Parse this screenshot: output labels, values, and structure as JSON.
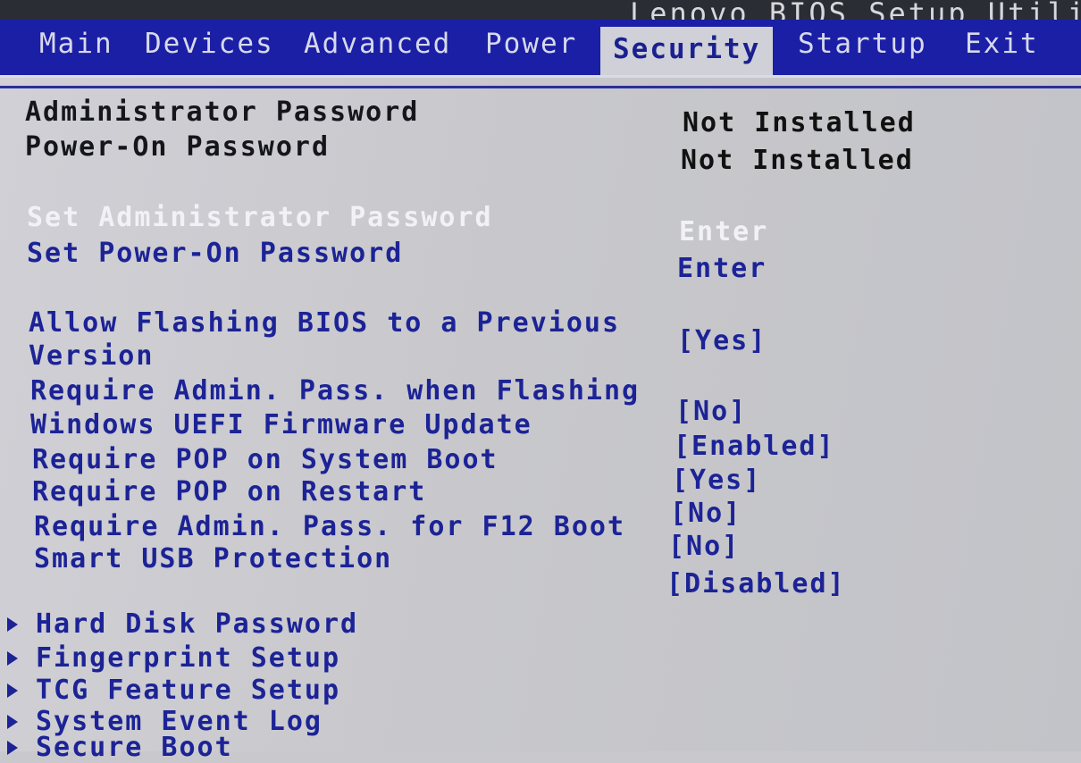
{
  "header": {
    "title": "Lenovo BIOS Setup Utilit"
  },
  "menu": [
    {
      "label": "Main"
    },
    {
      "label": "Devices"
    },
    {
      "label": "Advanced"
    },
    {
      "label": "Power"
    },
    {
      "label": "Security",
      "active": true
    },
    {
      "label": "Startup"
    },
    {
      "label": "Exit"
    }
  ],
  "status": [
    {
      "label": "Administrator Password",
      "value": "Not Installed"
    },
    {
      "label": "Power-On Password",
      "value": "Not Installed"
    }
  ],
  "actions": [
    {
      "label": "Set Administrator Password",
      "value": "Enter",
      "selected": true
    },
    {
      "label": "Set Power-On Password",
      "value": "Enter"
    }
  ],
  "settings": [
    {
      "label_line1": "Allow Flashing BIOS to a Previous",
      "label_line2": "Version",
      "value": "[Yes]"
    },
    {
      "label": "Require Admin. Pass. when Flashing",
      "value": "[No]"
    },
    {
      "label": "Windows UEFI Firmware Update",
      "value": "[Enabled]"
    },
    {
      "label": "Require POP on System Boot",
      "value": "[Yes]"
    },
    {
      "label": "Require POP on Restart",
      "value": "[No]"
    },
    {
      "label": "Require Admin. Pass. for F12 Boot",
      "value": "[No]"
    },
    {
      "label": "Smart USB Protection",
      "value": "[Disabled]"
    }
  ],
  "submenus": [
    {
      "label": "Hard Disk Password"
    },
    {
      "label": "Fingerprint Setup"
    },
    {
      "label": "TCG Feature Setup"
    },
    {
      "label": "System Event Log"
    },
    {
      "label": "Secure Boot"
    }
  ],
  "colors": {
    "menubar": "#1b1fa6",
    "active_tab_bg": "#cfd0d8",
    "text_blue": "#1c2396",
    "highlight_white": "#f2f2f6"
  },
  "icons": {
    "submenu_marker": "submenu-arrow-icon"
  }
}
